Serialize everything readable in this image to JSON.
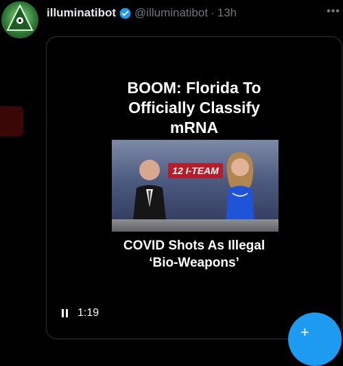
{
  "tweet": {
    "display_name": "illuminatibot",
    "handle": "@illuminatibot",
    "separator": "·",
    "time": "13h"
  },
  "media": {
    "headline_top_lines": [
      "BOOM: Florida To",
      "Officially Classify",
      "mRNA"
    ],
    "headline_bottom_lines": [
      "COVID Shots As Illegal",
      "‘Bio-Weapons’"
    ],
    "studio_logo_text": "12 I-TEAM",
    "duration": "1:19",
    "player_state": "playing",
    "icons": {
      "pause": "pause-icon",
      "compose": "compose-icon",
      "verified": "verified-badge-icon",
      "more": "more-options-icon"
    }
  },
  "colors": {
    "background": "#000000",
    "accent": "#1d9bf0",
    "muted_text": "#71767b",
    "primary_text": "#e7e9ea"
  }
}
